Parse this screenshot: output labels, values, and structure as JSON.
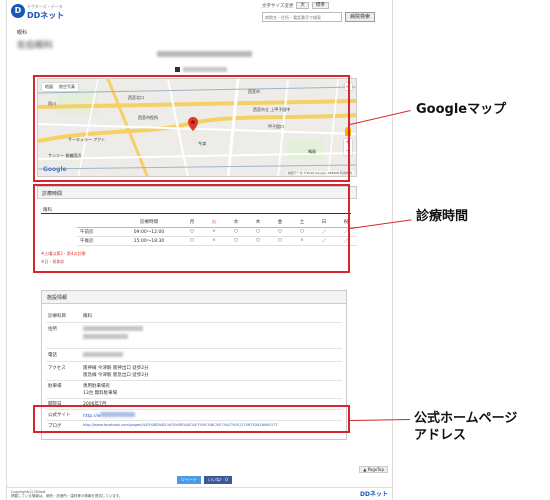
{
  "header": {
    "logo_text": "DDネット",
    "logo_sub": "ドクターズ・データ",
    "links": [
      "文字サイズ変更",
      "大",
      "標準"
    ],
    "search_placeholder": "病院名・住所・電話番号で検索",
    "search_button": "病院検索"
  },
  "breadcrumb": "眼科",
  "clinic_title": "佐伯眼科",
  "map": {
    "view_tabs": [
      "地図",
      "航空写真"
    ],
    "fullscreen": "⤢",
    "zoom_in": "+",
    "zoom_out": "−",
    "google_logo": "Google",
    "credit": "地図データ ©2016 Google, ZENRIN 利用規約",
    "labels": [
      "西宮市",
      "西宮市立 上甲子園中",
      "サーキュラー アクト",
      "甲子園口",
      "西宮北口",
      "今津",
      "西宮市役所",
      "夙川",
      "鳴尾",
      "サンリー 香櫨園浜"
    ]
  },
  "hours": {
    "title": "診療時間",
    "dept": "眼科",
    "columns": [
      "診療時間",
      "月",
      "火",
      "水",
      "木",
      "金",
      "土",
      "日",
      "祝"
    ],
    "rows": [
      {
        "label": "午前診",
        "time": "09:00～12:00",
        "marks": [
          "○",
          "×",
          "○",
          "○",
          "○",
          "○",
          "／",
          "／"
        ]
      },
      {
        "label": "午後診",
        "time": "15:00～18:30",
        "marks": [
          "○",
          "×",
          "○",
          "○",
          "○",
          "×",
          "／",
          "／"
        ]
      }
    ],
    "notes": [
      "※土曜は第2・第4の診療",
      "※日・祝休診"
    ]
  },
  "info": {
    "title": "施設情報",
    "rows": [
      {
        "key": "診療科目",
        "value": "眼科"
      },
      {
        "key": "住所",
        "value": ""
      },
      {
        "key": "電話",
        "value": ""
      },
      {
        "key": "アクセス",
        "value": "阪神線 今津駅 阪神出口 徒歩2分"
      },
      {
        "key": "",
        "value": "阪急線 今津駅 阪急出口 徒歩2分"
      },
      {
        "key": "駐車場",
        "value": "専用駐車場有"
      },
      {
        "key": "",
        "value": "13台 無料駐車場"
      },
      {
        "key": "開院日",
        "value": "2006年7月"
      },
      {
        "key": "公式サイト",
        "value": "http://w"
      },
      {
        "key": "ブログ",
        "value": "http://www.facebook.com/pages/%E5%BD%B1%E5%BE%8C%E7%9C%BC%E7%A7%91/1756792816060177"
      }
    ]
  },
  "share": {
    "twitter": "ツイート",
    "facebook": "いいね！ 0"
  },
  "page_top": "▲ PageTop",
  "footer": {
    "copy": "Copyright(C) DDnet",
    "note": "掲載している情報は、病院・診療所・歯科等の情報を提供しています。",
    "logo": "DDネット"
  },
  "callouts": {
    "map": "Googleマップ",
    "hours": "診療時間",
    "homepage_line1": "公式ホームページ",
    "homepage_line2": "アドレス"
  },
  "colors": {
    "highlight": "#d7252d",
    "brand": "#1a56b5",
    "link": "#2f5bb7"
  }
}
